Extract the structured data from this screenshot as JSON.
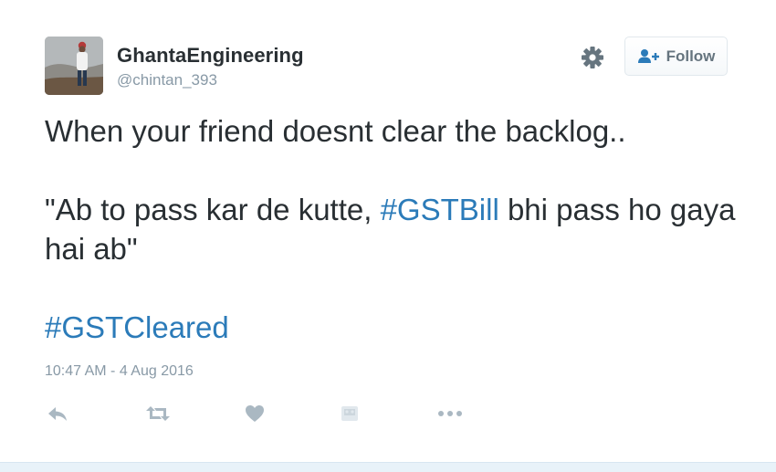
{
  "author": {
    "name": "GhantaEngineering",
    "handle": "@chintan_393"
  },
  "header": {
    "settings_icon": "gear-icon",
    "follow_icon": "follow-user-icon",
    "follow_label": "Follow"
  },
  "tweet": {
    "line1": "When your friend doesnt clear the backlog..",
    "line2_before": "\"Ab to pass kar de kutte, ",
    "hashtag_inline": "#GSTBill",
    "line2_after": " bhi pass ho gaya hai ab\"",
    "hashtag_final": "#GSTCleared",
    "timestamp": "10:47 AM - 4 Aug 2016"
  },
  "actions": [
    "reply-icon",
    "retweet-icon",
    "like-icon",
    "grayed-media-icon",
    "more-icon"
  ],
  "colors": {
    "text": "#292f33",
    "secondary": "#8899a6",
    "link": "#2b7bb9",
    "action_icon": "#aab8c2",
    "follow_icon": "#2b7bb9"
  }
}
